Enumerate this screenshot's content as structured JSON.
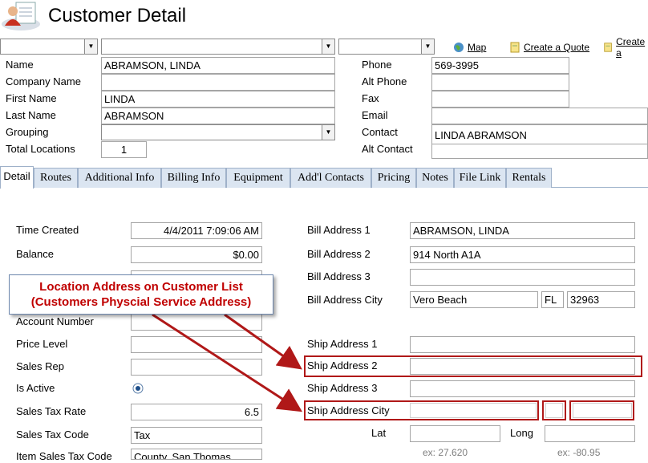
{
  "header": {
    "title": "Customer Detail"
  },
  "toolbar": {
    "map_label": "Map",
    "quote_label": "Create a Quote",
    "create2_label": "Create a"
  },
  "customer": {
    "name_label": "Name",
    "name": "ABRAMSON, LINDA",
    "company_label": "Company Name",
    "company": "",
    "first_label": "First Name",
    "first": "LINDA",
    "last_label": "Last Name",
    "last": "ABRAMSON",
    "grouping_label": "Grouping",
    "grouping": "",
    "locations_label": "Total Locations",
    "locations": "1",
    "phone_label": "Phone",
    "phone": "569-3995",
    "altphone_label": "Alt Phone",
    "altphone": "",
    "fax_label": "Fax",
    "fax": "",
    "email_label": "Email",
    "email": "",
    "contact_label": "Contact",
    "contact": "LINDA ABRAMSON",
    "altcontact_label": "Alt Contact",
    "altcontact": ""
  },
  "tabs": [
    "Detail",
    "Routes",
    "Additional Info",
    "Billing Info",
    "Equipment",
    "Add'l Contacts",
    "Pricing",
    "Notes",
    "File Link",
    "Rentals"
  ],
  "detail": {
    "time_label": "Time Created",
    "time": "4/4/2011 7:09:06 AM",
    "balance_label": "Balance",
    "balance": "$0.00",
    "account_label": "Account Number",
    "account": "",
    "price_label": "Price Level",
    "price": "",
    "rep_label": "Sales Rep",
    "rep": "",
    "active_label": "Is Active",
    "taxrate_label": "Sales Tax Rate",
    "taxrate": "6.5",
    "taxcode_label": "Sales Tax Code",
    "taxcode": "Tax",
    "itemtax_label": "Item Sales Tax Code",
    "itemtax": "County, San Thomas",
    "bill1_label": "Bill Address 1",
    "bill1": "ABRAMSON, LINDA",
    "bill2_label": "Bill Address 2",
    "bill2": "914 North A1A",
    "bill3_label": "Bill Address 3",
    "bill3": "",
    "billcity_label": "Bill Address City",
    "billcity": "Vero Beach",
    "billstate": "FL",
    "billzip": "32963",
    "ship1_label": "Ship Address 1",
    "ship2_label": "Ship Address 2",
    "ship3_label": "Ship Address 3",
    "shipcity_label": "Ship Address City",
    "lat_label": "Lat",
    "long_label": "Long",
    "lat_hint": "ex: 27.620",
    "long_hint": "ex: -80.95"
  },
  "callout": {
    "line1": "Location Address on Customer List",
    "line2": "(Customers Physcial Service Address)"
  },
  "colors": {
    "accent_red": "#b01818",
    "tab_bg": "#dbe5f1"
  }
}
